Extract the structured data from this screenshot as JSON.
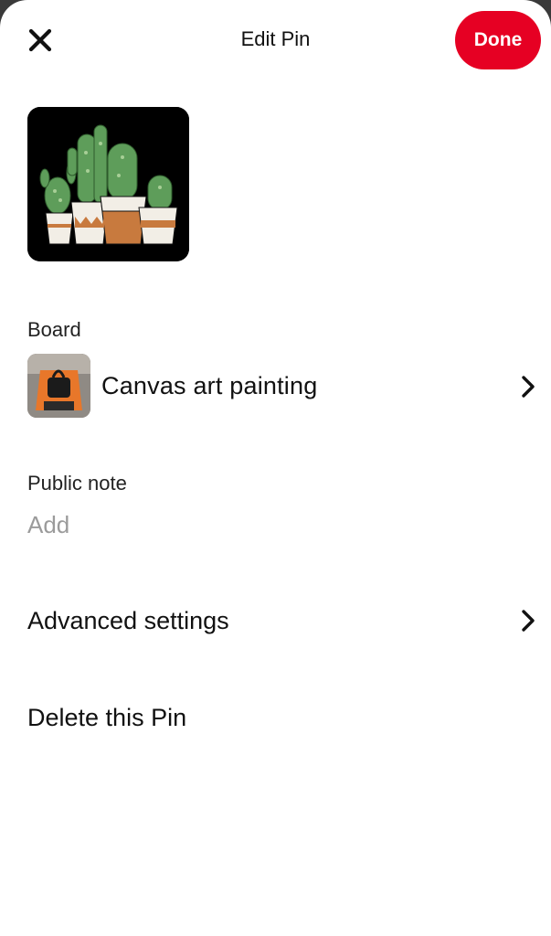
{
  "header": {
    "title": "Edit Pin",
    "done_label": "Done",
    "close_icon": "close-icon"
  },
  "pin": {
    "image_icon": "cactus-pots-illustration"
  },
  "board": {
    "label": "Board",
    "name": "Canvas art painting",
    "chevron_icon": "chevron-right-icon"
  },
  "public_note": {
    "label": "Public note",
    "placeholder": "Add"
  },
  "advanced": {
    "label": "Advanced settings",
    "chevron_icon": "chevron-right-icon"
  },
  "delete": {
    "label": "Delete this Pin"
  },
  "colors": {
    "accent": "#e60023",
    "text": "#111111",
    "muted": "#9b9b9b"
  }
}
